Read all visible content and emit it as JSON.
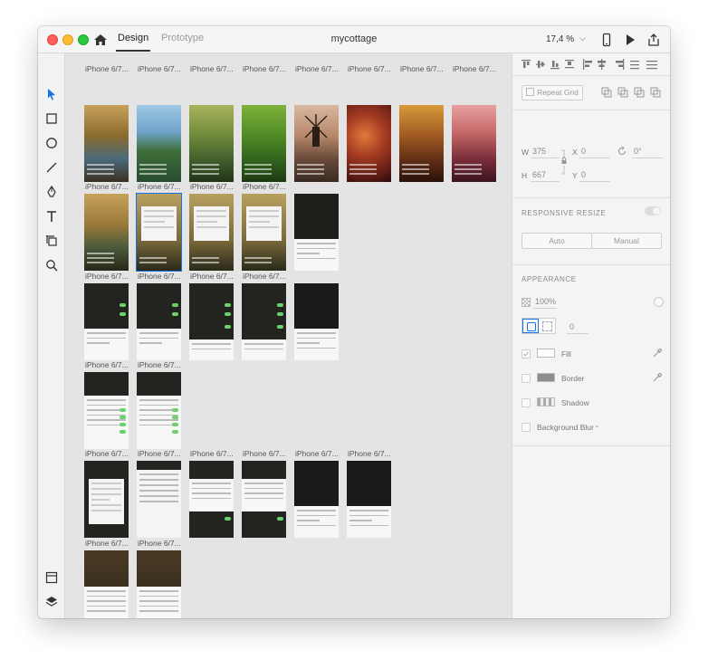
{
  "app": {
    "document_title": "mycottage",
    "tabs": [
      {
        "label": "Design",
        "active": true
      },
      {
        "label": "Prototype",
        "active": false
      }
    ],
    "zoom": "17,4 %"
  },
  "toolbar_tools": [
    {
      "name": "select-tool-icon",
      "active": true
    },
    {
      "name": "rectangle-tool-icon"
    },
    {
      "name": "ellipse-tool-icon"
    },
    {
      "name": "line-tool-icon"
    },
    {
      "name": "pen-tool-icon"
    },
    {
      "name": "text-tool-icon"
    },
    {
      "name": "artboard-tool-icon"
    },
    {
      "name": "zoom-tool-icon"
    }
  ],
  "canvas": {
    "artboard_label": "iPhone 6/7...",
    "artboard_selected_label": "iPhone 6/7..."
  },
  "properties": {
    "repeat_grid": "Repeat Grid",
    "w_label": "W",
    "w_value": "375",
    "x_label": "X",
    "x_value": "0",
    "rotation_value": "0°",
    "h_label": "H",
    "h_value": "667",
    "y_label": "Y",
    "y_value": "0",
    "responsive_resize": "RESPONSIVE RESIZE",
    "auto": "Auto",
    "manual": "Manual",
    "appearance": "APPEARANCE",
    "opacity": "100%",
    "corner_radius": "0",
    "fill": "Fill",
    "border": "Border",
    "shadow": "Shadow",
    "background_blur": "Background Blur"
  },
  "colors": {
    "accent": "#1473e6"
  }
}
